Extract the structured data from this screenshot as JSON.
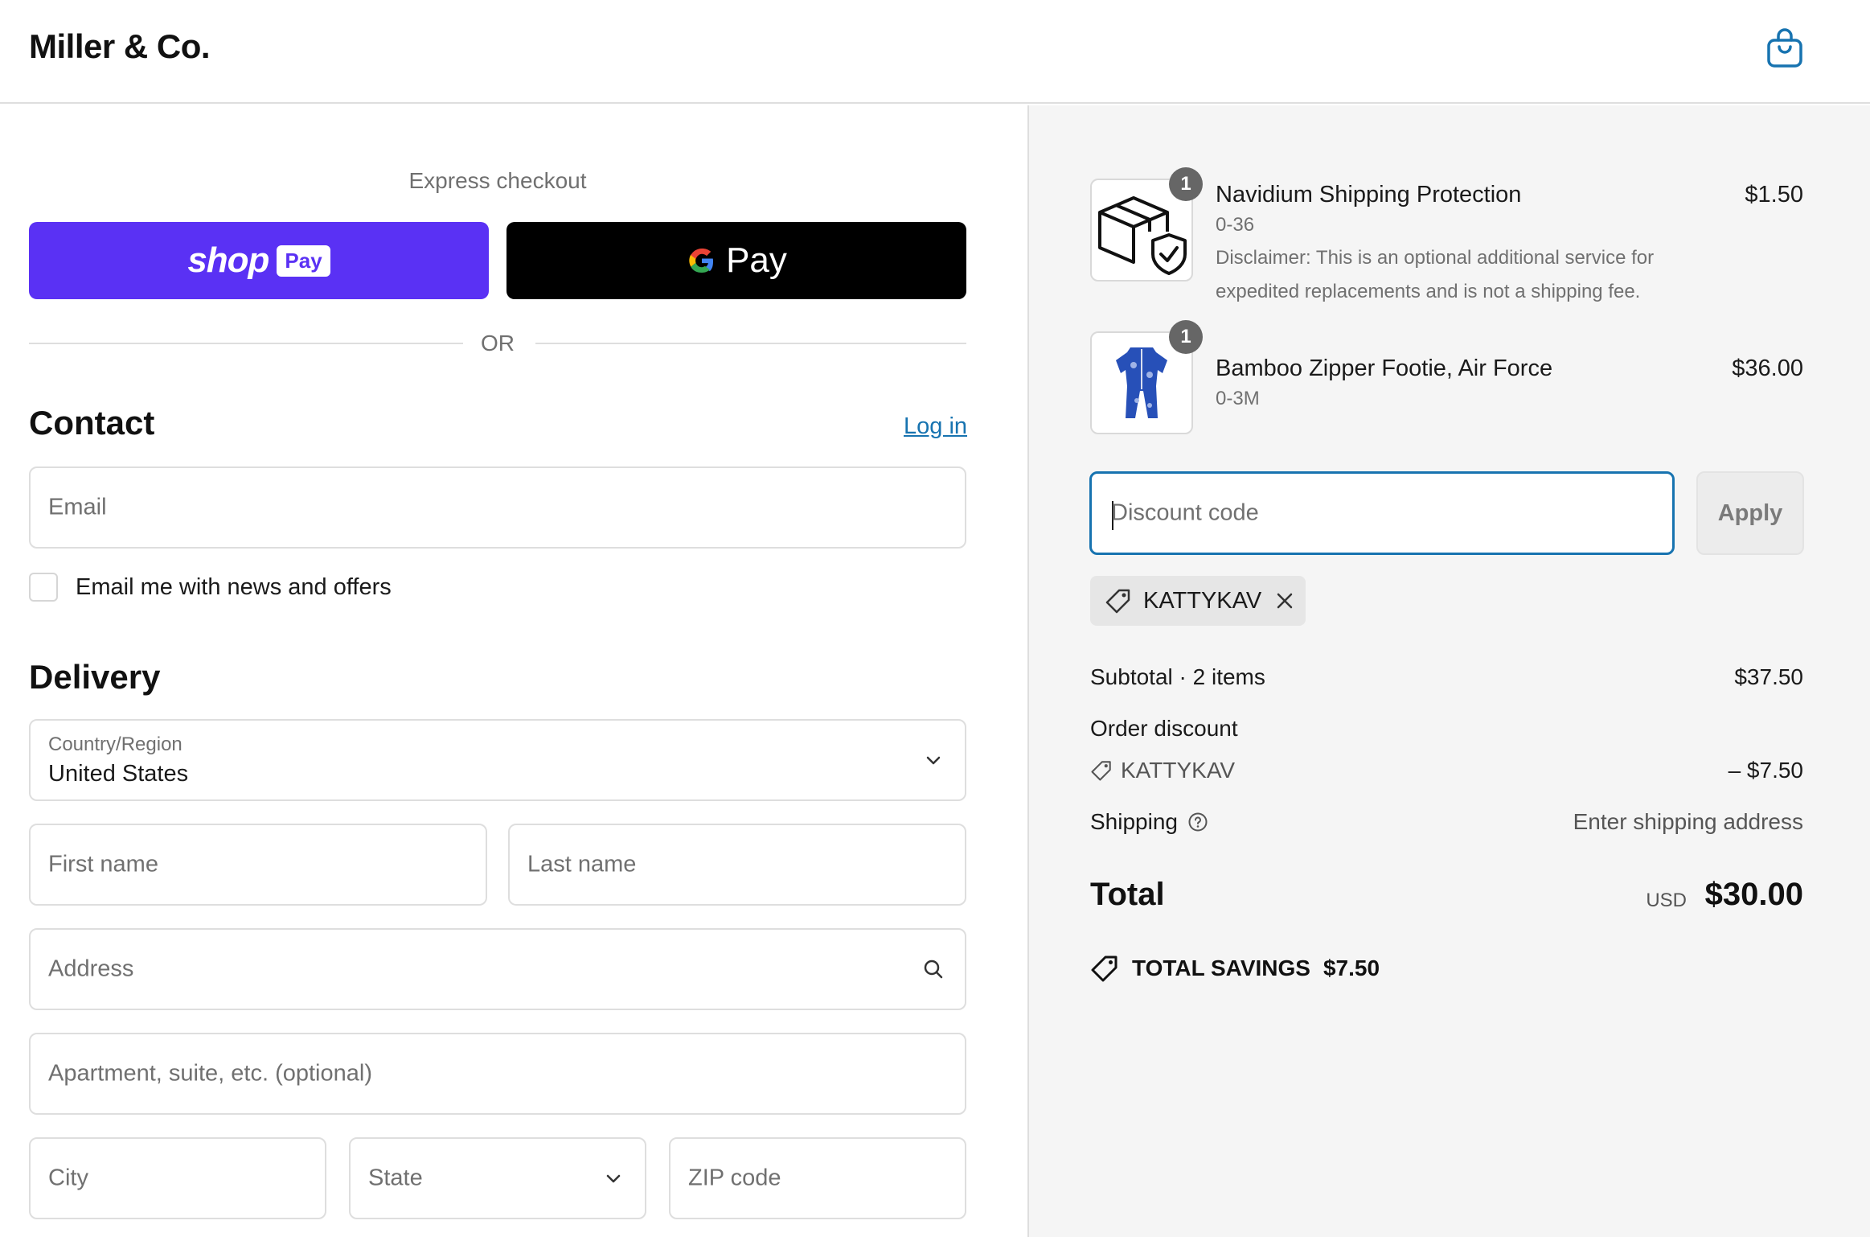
{
  "header": {
    "brand": "Miller & Co.",
    "cart_icon": "shopping-bag-icon"
  },
  "express": {
    "label": "Express checkout",
    "shop_pay": {
      "text": "shop",
      "badge": "Pay",
      "color": "#5a31f4"
    },
    "google_pay": {
      "text": "Pay"
    },
    "or_label": "OR"
  },
  "contact": {
    "title": "Contact",
    "login_label": "Log in",
    "email_placeholder": "Email",
    "newsletter_label": "Email me with news and offers"
  },
  "delivery": {
    "title": "Delivery",
    "country_label": "Country/Region",
    "country_value": "United States",
    "first_name": "First name",
    "last_name": "Last name",
    "address": "Address",
    "apartment": "Apartment, suite, etc. (optional)",
    "city": "City",
    "state": "State",
    "zip": "ZIP code"
  },
  "order": {
    "items": [
      {
        "name": "Navidium Shipping Protection",
        "variant": "0-36",
        "price": "$1.50",
        "qty": "1",
        "disclaimer": "Disclaimer: This is an optional additional service for expedited replacements and is not a shipping fee."
      },
      {
        "name": "Bamboo Zipper Footie, Air Force",
        "variant": "0-3M",
        "price": "$36.00",
        "qty": "1"
      }
    ],
    "discount_placeholder": "Discount code",
    "apply_label": "Apply",
    "applied_code": "KATTYKAV"
  },
  "summary": {
    "subtotal_label": "Subtotal · 2 items",
    "subtotal_value": "$37.50",
    "order_discount_label": "Order discount",
    "discount_code": "KATTYKAV",
    "discount_value": "– $7.50",
    "shipping_label": "Shipping",
    "shipping_value": "Enter shipping address",
    "total_label": "Total",
    "currency": "USD",
    "total_value": "$30.00",
    "savings_label": "TOTAL SAVINGS",
    "savings_value": "$7.50"
  },
  "colors": {
    "accent": "#1773b0",
    "shop_pay": "#5a31f4",
    "gpay": "#000000"
  }
}
